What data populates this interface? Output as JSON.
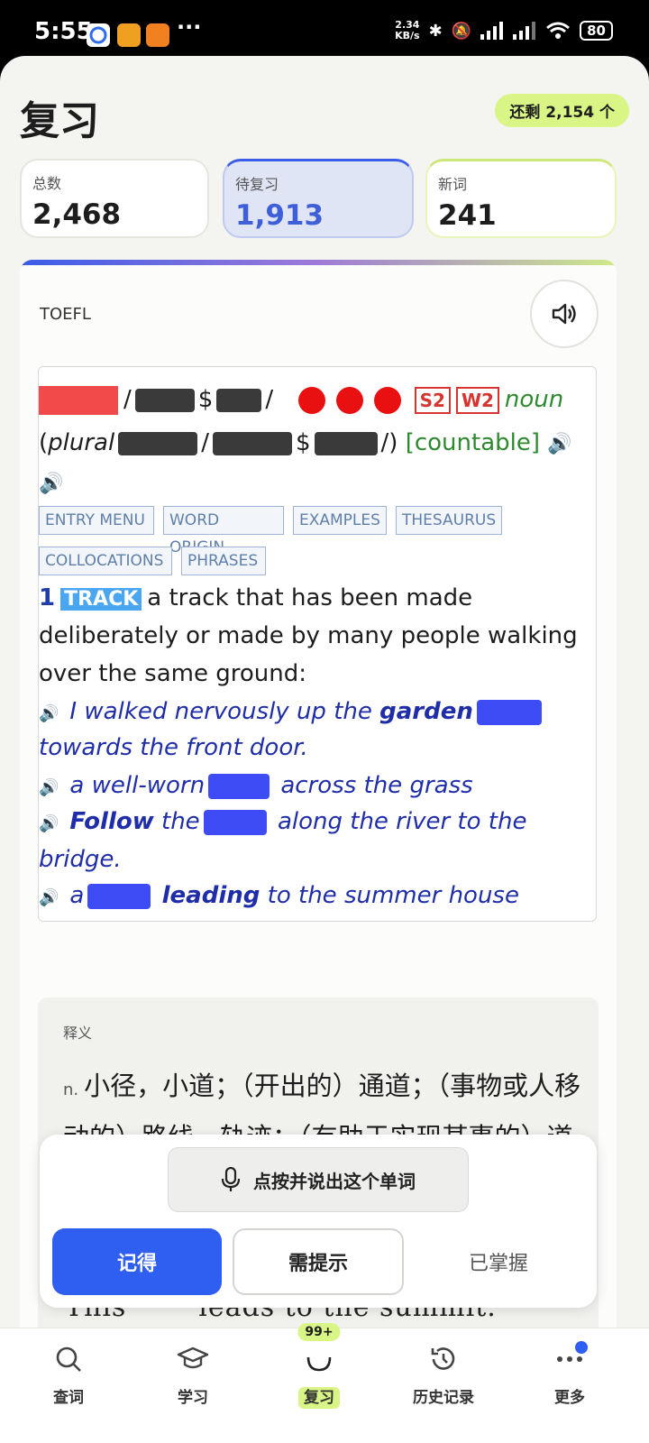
{
  "status_bar": {
    "time": "5:55",
    "net_speed_value": "2.34",
    "net_speed_unit": "KB/s",
    "battery": "80",
    "more": "···"
  },
  "header": {
    "title": "复习",
    "remaining": "还剩 2,154 个"
  },
  "stats": [
    {
      "label": "总数",
      "value": "2,468"
    },
    {
      "label": "待复习",
      "value": "1,913"
    },
    {
      "label": "新词",
      "value": "241"
    }
  ],
  "card": {
    "source": "TOEFL",
    "dict": {
      "freq_spoken": "S2",
      "freq_written": "W2",
      "pos": "noun",
      "plural_label": "plural",
      "grammar": "[countable]",
      "tags": [
        "ENTRY MENU",
        "WORD ORIGIN",
        "EXAMPLES",
        "THESAURUS",
        "COLLOCATIONS",
        "PHRASES"
      ],
      "sense_number": "1",
      "sense_signpost": "TRACK",
      "definition_l1": "a track that has been made",
      "definition_l2": "deliberately or made by many people walking",
      "definition_l3": "over the same ground:",
      "examples": {
        "e1_pre": "I walked nervously up the",
        "e1_bold": "garden",
        "e1_cont": "towards the front door.",
        "e2_pre": "a well-worn",
        "e2_post": "across the grass",
        "e3_bold": "Follow",
        "e3_pre": "the",
        "e3_post": "along the river to the",
        "e3_cont": "bridge.",
        "e4_pre": "a",
        "e4_bold": "leading",
        "e4_post": "to the summer house"
      }
    },
    "meaning": {
      "title": "释义",
      "pos": "n.",
      "text": "小径，小道；（开出的）通道；（事物或人移动的）路线，轨迹；（有助于实现某事的）道路，途径；通勤火车时刻表；"
    },
    "peek_sentence_a": "This",
    "peek_sentence_b": "leads to the summit."
  },
  "actions": {
    "voice": "点按并说出这个单词",
    "remember": "记得",
    "hint": "需提示",
    "mastered": "已掌握"
  },
  "tabs": [
    {
      "label": "查词",
      "icon": "search-icon"
    },
    {
      "label": "学习",
      "icon": "graduation-cap-icon"
    },
    {
      "label": "复习",
      "icon": "review-icon",
      "badge": "99+"
    },
    {
      "label": "历史记录",
      "icon": "history-icon"
    },
    {
      "label": "更多",
      "icon": "more-icon"
    }
  ],
  "colors": {
    "accent": "#2f5ff0",
    "lime": "#d8f585",
    "example_blue": "#1f2ea8",
    "grammar_green": "#2e8a2e"
  }
}
